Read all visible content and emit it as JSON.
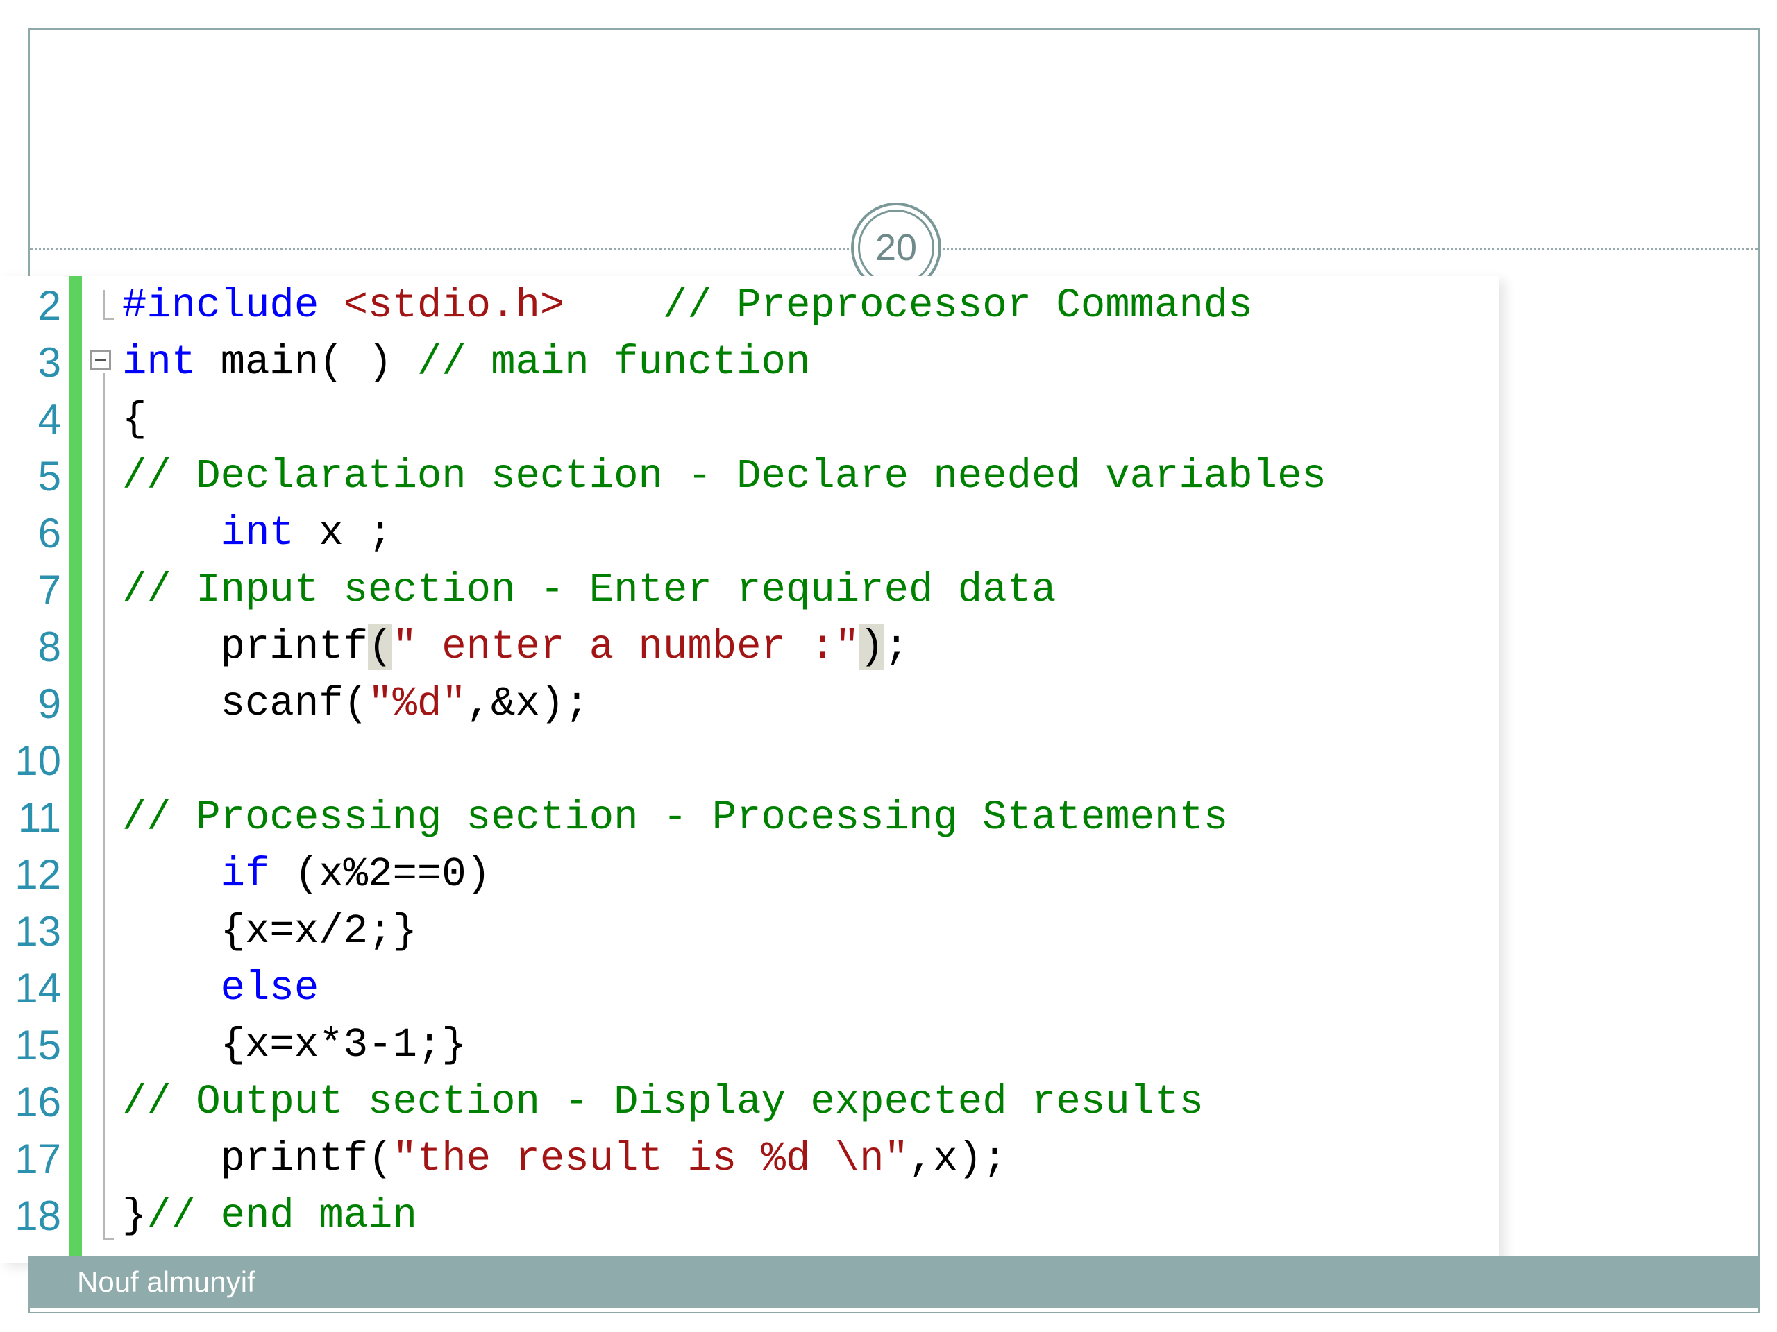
{
  "slide": {
    "page_number": "20",
    "footer_author": "Nouf almunyif"
  },
  "editor": {
    "line_numbers": [
      "2",
      "3",
      "4",
      "5",
      "6",
      "7",
      "8",
      "9",
      "10",
      "11",
      "12",
      "13",
      "14",
      "15",
      "16",
      "17",
      "18"
    ],
    "lines": [
      [
        {
          "t": "k",
          "v": "#include"
        },
        {
          "t": "p",
          "v": " "
        },
        {
          "t": "s",
          "v": "<stdio.h>"
        },
        {
          "t": "p",
          "v": "    "
        },
        {
          "t": "c",
          "v": "// Preprocessor Commands"
        }
      ],
      [
        {
          "t": "k",
          "v": "int"
        },
        {
          "t": "p",
          "v": " main( ) "
        },
        {
          "t": "c",
          "v": "// main function"
        }
      ],
      [
        {
          "t": "p",
          "v": "{"
        }
      ],
      [
        {
          "t": "c",
          "v": "// Declaration section - Declare needed variables"
        }
      ],
      [
        {
          "t": "p",
          "v": "    "
        },
        {
          "t": "k",
          "v": "int"
        },
        {
          "t": "p",
          "v": " x ;"
        }
      ],
      [
        {
          "t": "c",
          "v": "// Input section - Enter required data"
        }
      ],
      [
        {
          "t": "p",
          "v": "    printf"
        },
        {
          "t": "paren",
          "v": "("
        },
        {
          "t": "s",
          "v": "\" enter a number :\""
        },
        {
          "t": "paren",
          "v": ")"
        },
        {
          "t": "p",
          "v": ";"
        }
      ],
      [
        {
          "t": "p",
          "v": "    scanf("
        },
        {
          "t": "s",
          "v": "\"%d\""
        },
        {
          "t": "p",
          "v": ",&x);"
        }
      ],
      [],
      [
        {
          "t": "c",
          "v": "// Processing section - Processing Statements"
        }
      ],
      [
        {
          "t": "p",
          "v": "    "
        },
        {
          "t": "k",
          "v": "if"
        },
        {
          "t": "p",
          "v": " (x%2==0)"
        }
      ],
      [
        {
          "t": "p",
          "v": "    {x=x/2;}"
        }
      ],
      [
        {
          "t": "p",
          "v": "    "
        },
        {
          "t": "k",
          "v": "else"
        }
      ],
      [
        {
          "t": "p",
          "v": "    {x=x*3-1;}"
        }
      ],
      [
        {
          "t": "c",
          "v": "// Output section - Display expected results"
        }
      ],
      [
        {
          "t": "p",
          "v": "    printf("
        },
        {
          "t": "s",
          "v": "\"the result is %d \\n\""
        },
        {
          "t": "p",
          "v": ",x);"
        }
      ],
      [
        {
          "t": "p",
          "v": "}"
        },
        {
          "t": "c",
          "v": "// end main"
        }
      ]
    ]
  }
}
